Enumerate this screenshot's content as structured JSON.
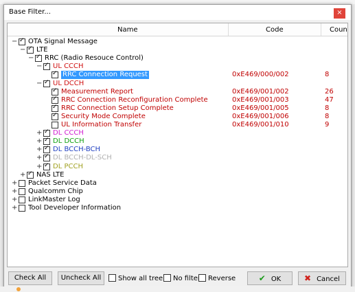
{
  "window": {
    "title": "Base Filter...",
    "close_glyph": "×"
  },
  "columns": {
    "name": "Name",
    "code": "Code",
    "count": "Count"
  },
  "tree": [
    {
      "label": "OTA Signal Message",
      "expander": "−",
      "checked": true,
      "color": "#000000",
      "code": "",
      "count": ""
    },
    {
      "label": "LTE",
      "expander": "−",
      "checked": true,
      "color": "#000000",
      "code": "",
      "count": ""
    },
    {
      "label": "RRC (Radio Resouce Control)",
      "expander": "−",
      "checked": true,
      "color": "#000000",
      "code": "",
      "count": ""
    },
    {
      "label": "UL CCCH",
      "expander": "−",
      "checked": true,
      "color": "#d01010",
      "code": "",
      "count": ""
    },
    {
      "label": "RRC Connection Request",
      "expander": "",
      "checked": true,
      "color": "#ffffff",
      "selected": true,
      "code": "0xE469/000/002",
      "count": "8"
    },
    {
      "label": "UL DCCH",
      "expander": "−",
      "checked": true,
      "color": "#d01010",
      "code": "",
      "count": ""
    },
    {
      "label": "Measurement Report",
      "expander": "",
      "checked": true,
      "color": "#c00000",
      "code": "0xE469/001/002",
      "count": "26"
    },
    {
      "label": "RRC Connection Reconfiguration Complete",
      "expander": "",
      "checked": true,
      "color": "#c00000",
      "code": "0xE469/001/003",
      "count": "47"
    },
    {
      "label": "RRC Connection Setup Complete",
      "expander": "",
      "checked": true,
      "color": "#c00000",
      "code": "0xE469/001/005",
      "count": "8"
    },
    {
      "label": "Security Mode Complete",
      "expander": "",
      "checked": true,
      "color": "#c00000",
      "code": "0xE469/001/006",
      "count": "8"
    },
    {
      "label": "UL Information Transfer",
      "expander": "",
      "checked": false,
      "color": "#c00000",
      "code": "0xE469/001/010",
      "count": "9"
    },
    {
      "label": "DL CCCH",
      "expander": "+",
      "checked": true,
      "color": "#d020d0",
      "code": "",
      "count": ""
    },
    {
      "label": "DL DCCH",
      "expander": "+",
      "checked": true,
      "color": "#10a010",
      "code": "",
      "count": ""
    },
    {
      "label": "DL BCCH-BCH",
      "expander": "+",
      "checked": true,
      "color": "#2040c0",
      "code": "",
      "count": ""
    },
    {
      "label": "DL BCCH-DL-SCH",
      "expander": "+",
      "checked": true,
      "color": "#b0b0b0",
      "code": "",
      "count": ""
    },
    {
      "label": "DL PCCH",
      "expander": "+",
      "checked": true,
      "color": "#a0a020",
      "code": "",
      "count": ""
    },
    {
      "label": "NAS LTE",
      "expander": "+",
      "checked": true,
      "color": "#000000",
      "code": "",
      "count": ""
    },
    {
      "label": "Packet Service Data",
      "expander": "+",
      "checked": false,
      "color": "#000000",
      "code": "",
      "count": ""
    },
    {
      "label": "Qualcomm Chip",
      "expander": "+",
      "checked": false,
      "color": "#000000",
      "code": "",
      "count": ""
    },
    {
      "label": "LinkMaster Log",
      "expander": "+",
      "checked": false,
      "color": "#000000",
      "code": "",
      "count": ""
    },
    {
      "label": "Tool Developer Information",
      "expander": "+",
      "checked": false,
      "color": "#000000",
      "code": "",
      "count": ""
    }
  ],
  "footer": {
    "check_all": "Check All",
    "uncheck_all": "Uncheck All",
    "show_all_tree": "Show all tree",
    "no_filter": "No filter",
    "reverse": "Reverse",
    "ok": "OK",
    "cancel": "Cancel"
  }
}
